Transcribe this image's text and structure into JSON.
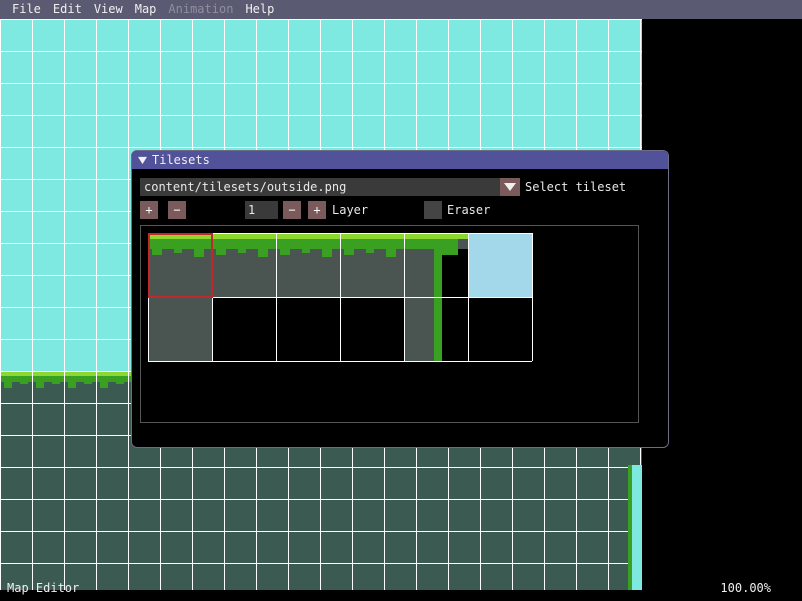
{
  "menu": {
    "items": [
      {
        "label": "File",
        "enabled": true
      },
      {
        "label": "Edit",
        "enabled": true
      },
      {
        "label": "View",
        "enabled": true
      },
      {
        "label": "Map",
        "enabled": true
      },
      {
        "label": "Animation",
        "enabled": false
      },
      {
        "label": "Help",
        "enabled": true
      }
    ]
  },
  "tileset_window": {
    "title": "Tilesets",
    "tileset_path": "content/tilesets/outside.png",
    "select_label": "Select tileset",
    "plus_label": "+",
    "minus_label": "−",
    "layer_value": "1",
    "layer_label": "Layer",
    "eraser_label": "Eraser",
    "eraser_checked": false,
    "selected_tile": 0
  },
  "status": {
    "left": "Map Editor",
    "zoom": "100.00%"
  },
  "colors": {
    "sky": "#7de9e1",
    "dirt": "#3a5a52",
    "grass_light": "#8ed630",
    "grass_dark": "#3aa022",
    "rock": "#4a5450",
    "water": "#a2d8ea",
    "selection": "#c0282a"
  },
  "icons": {
    "collapse": "triangle-down-icon",
    "combo_arrow": "triangle-down-icon"
  }
}
